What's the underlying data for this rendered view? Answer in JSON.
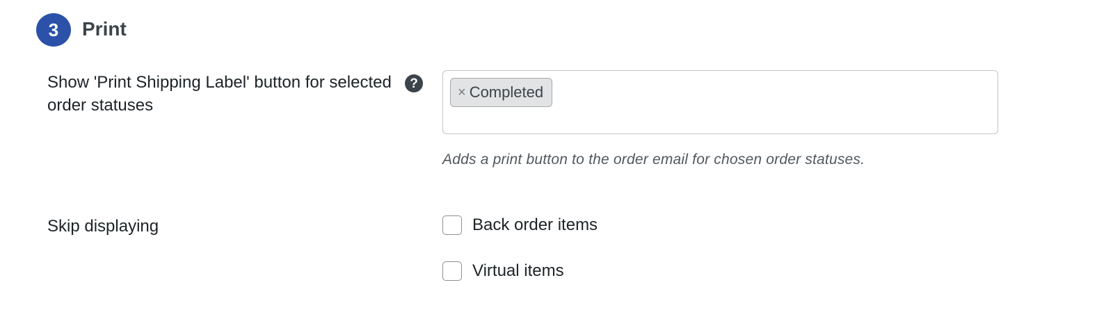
{
  "section": {
    "step_number": "3",
    "title": "Print"
  },
  "print_button_setting": {
    "label": "Show 'Print Shipping Label' button for selected order statuses",
    "help_icon": "question-mark-icon",
    "selected_statuses": [
      "Completed"
    ],
    "chip_remove_glyph": "×",
    "description": "Adds a print button to the order email for chosen order statuses."
  },
  "skip_displaying_setting": {
    "label": "Skip displaying",
    "options": [
      {
        "label": "Back order items",
        "checked": false
      },
      {
        "label": "Virtual items",
        "checked": false
      }
    ]
  },
  "colors": {
    "step_badge": "#2c51a8",
    "text": "#1d2327",
    "description": "#50575e",
    "chip_background": "#e2e3e4"
  }
}
